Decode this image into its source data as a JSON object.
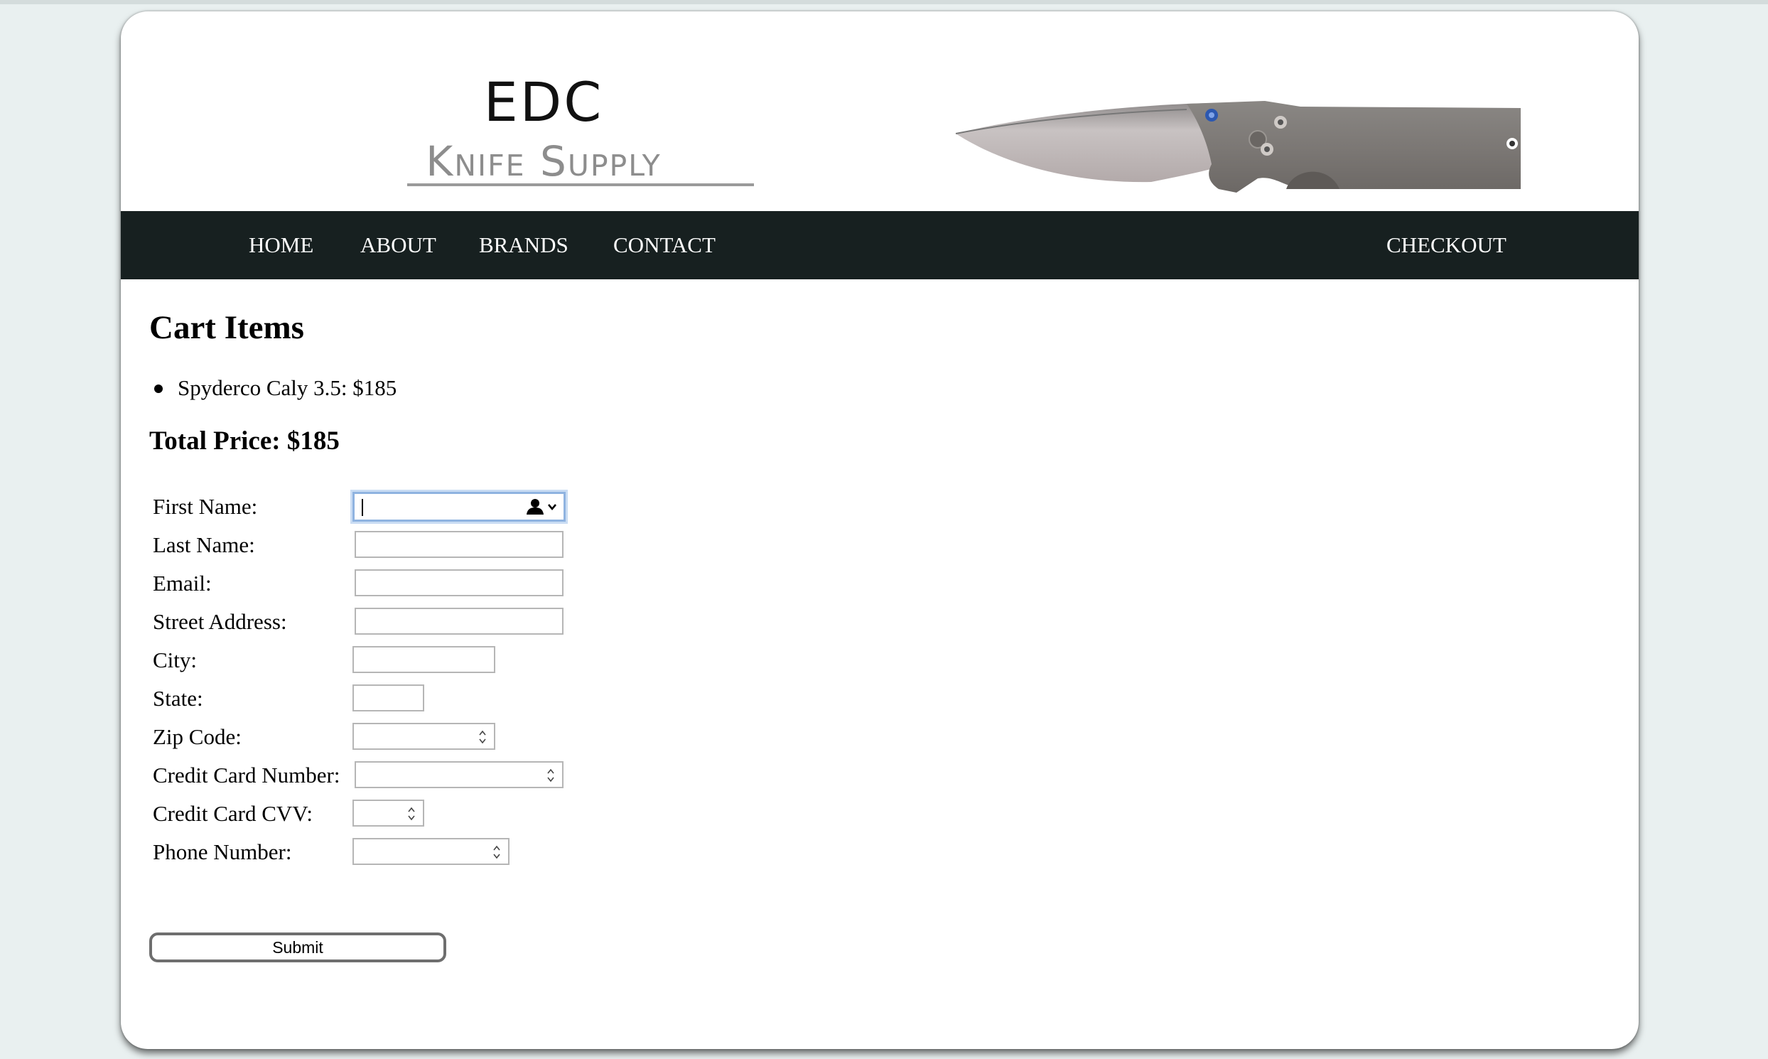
{
  "header": {
    "logo": {
      "line1": "EDC",
      "line2": "Knife Supply"
    },
    "banner_image": "folding-knife-image"
  },
  "nav": {
    "items": [
      {
        "label": "HOME"
      },
      {
        "label": "ABOUT"
      },
      {
        "label": "BRANDS"
      },
      {
        "label": "CONTACT"
      }
    ],
    "checkout": {
      "label": "CHECKOUT"
    }
  },
  "cart": {
    "heading": "Cart Items",
    "items": [
      {
        "text": "Spyderco Caly 3.5: $185"
      }
    ],
    "total_label": "Total Price: $185"
  },
  "form": {
    "fields": [
      {
        "label": "First Name:",
        "value": "",
        "type": "text",
        "focused": true,
        "icon": "autofill-contact-icon"
      },
      {
        "label": "Last Name:",
        "value": "",
        "type": "text"
      },
      {
        "label": "Email:",
        "value": "",
        "type": "email"
      },
      {
        "label": "Street Address:",
        "value": "",
        "type": "text"
      },
      {
        "label": "City:",
        "value": "",
        "type": "text"
      },
      {
        "label": "State:",
        "value": "",
        "type": "text"
      },
      {
        "label": "Zip Code:",
        "value": "",
        "type": "number"
      },
      {
        "label": "Credit Card Number:",
        "value": "",
        "type": "number"
      },
      {
        "label": "Credit Card CVV:",
        "value": "",
        "type": "number"
      },
      {
        "label": "Phone Number:",
        "value": "",
        "type": "number"
      }
    ],
    "submit_label": "Submit"
  },
  "colors": {
    "nav_background": "#172020",
    "page_background": "#e9f0f0",
    "logo_subtitle": "#8d8d8d",
    "focus_ring": "#8fb3e0"
  }
}
